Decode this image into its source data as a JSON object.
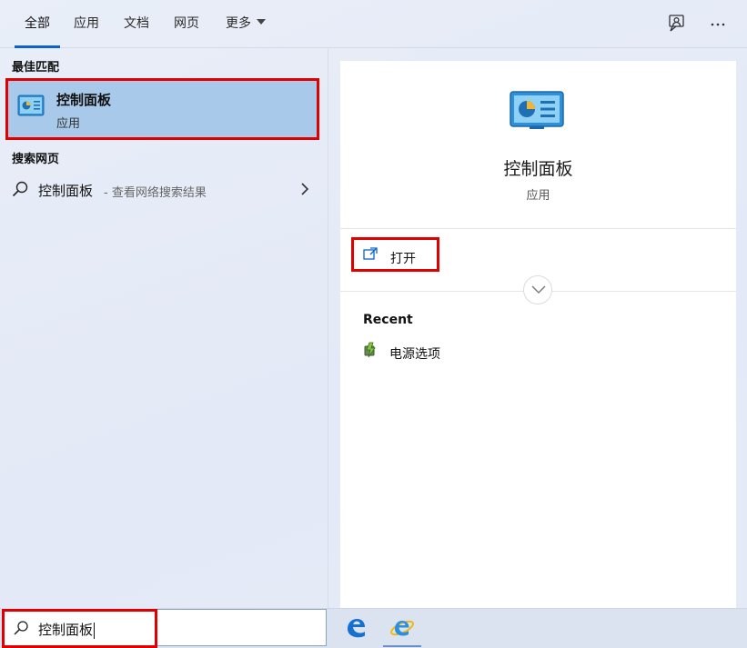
{
  "tabs": [
    {
      "label": "全部",
      "active": true
    },
    {
      "label": "应用",
      "active": false
    },
    {
      "label": "文档",
      "active": false
    },
    {
      "label": "网页",
      "active": false
    },
    {
      "label": "更多",
      "active": false
    }
  ],
  "top_actions": {
    "feedback_icon": "feedback-icon",
    "more_icon": "ellipsis-icon"
  },
  "best_match": {
    "section_label": "最佳匹配",
    "title": "控制面板",
    "subtitle": "应用",
    "icon": "control-panel-icon"
  },
  "web_search": {
    "section_label": "搜索网页",
    "term": "控制面板",
    "hint": "- 查看网络搜索结果"
  },
  "preview": {
    "title": "控制面板",
    "subtitle": "应用",
    "open_label": "打开",
    "recent_heading": "Recent",
    "recent_items": [
      {
        "label": "电源选项",
        "icon": "power-options-icon"
      }
    ]
  },
  "search_box": {
    "value": "控制面板",
    "icon": "search-icon"
  },
  "taskbar": {
    "apps": [
      "edge-legacy-icon",
      "internet-explorer-icon"
    ]
  },
  "colors": {
    "accent": "#0b63c9",
    "highlight_box": "#e00000",
    "selected_bg": "#a8c9e9"
  }
}
